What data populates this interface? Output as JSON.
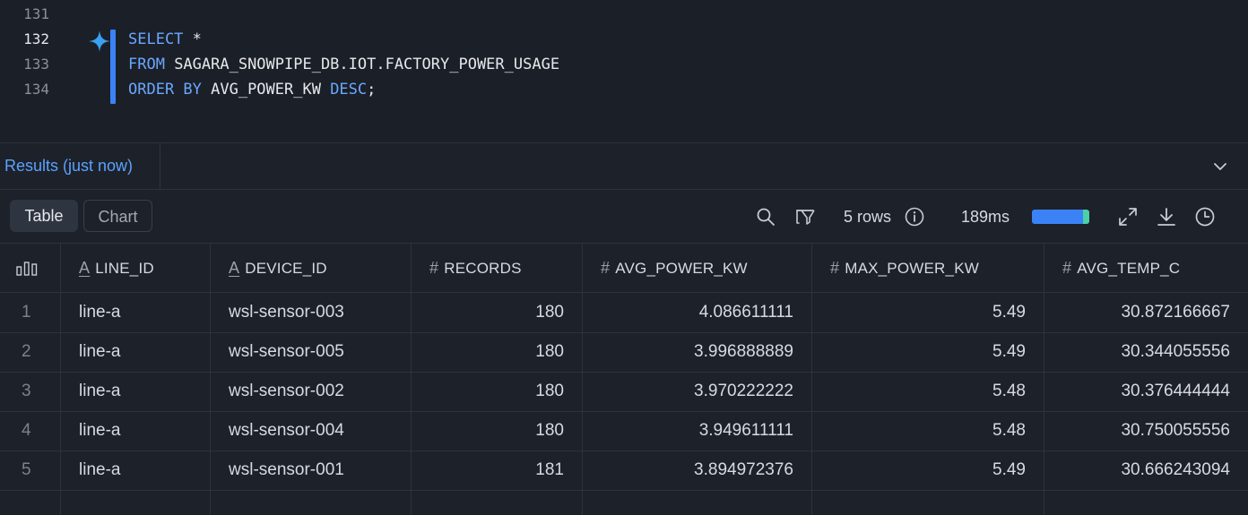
{
  "editor": {
    "lines": [
      {
        "number": "131",
        "tokens": []
      },
      {
        "number": "132",
        "tokens": [
          {
            "t": "SELECT",
            "kw": true
          },
          {
            "t": " *",
            "kw": false
          }
        ]
      },
      {
        "number": "133",
        "tokens": [
          {
            "t": "FROM",
            "kw": true
          },
          {
            "t": " SAGARA_SNOWPIPE_DB.IOT.FACTORY_POWER_USAGE",
            "kw": false
          }
        ]
      },
      {
        "number": "134",
        "tokens": [
          {
            "t": "ORDER BY",
            "kw": true
          },
          {
            "t": " AVG_POWER_KW ",
            "kw": false
          },
          {
            "t": "DESC",
            "kw": true
          },
          {
            "t": ";",
            "kw": false
          }
        ]
      }
    ],
    "active_line": "132",
    "gutter_icon": "ai-sparkle-icon"
  },
  "results": {
    "tab_label": "Results (just now)",
    "collapse_icon": "chevron-down-icon",
    "view_tabs": {
      "table": "Table",
      "chart": "Chart"
    },
    "row_count": "5 rows",
    "duration": "189ms",
    "duration_progress": 1.0,
    "icons": [
      "search-icon",
      "filter-icon",
      "info-icon",
      "expand-icon",
      "download-icon",
      "history-icon"
    ],
    "columns": [
      {
        "name": "",
        "type": "stats"
      },
      {
        "name": "LINE_ID",
        "type": "A"
      },
      {
        "name": "DEVICE_ID",
        "type": "A"
      },
      {
        "name": "RECORDS",
        "type": "#"
      },
      {
        "name": "AVG_POWER_KW",
        "type": "#"
      },
      {
        "name": "MAX_POWER_KW",
        "type": "#"
      },
      {
        "name": "AVG_TEMP_C",
        "type": "#"
      }
    ],
    "rows": [
      [
        "1",
        "line-a",
        "wsl-sensor-003",
        "180",
        "4.086611111",
        "5.49",
        "30.872166667"
      ],
      [
        "2",
        "line-a",
        "wsl-sensor-005",
        "180",
        "3.996888889",
        "5.49",
        "30.344055556"
      ],
      [
        "3",
        "line-a",
        "wsl-sensor-002",
        "180",
        "3.970222222",
        "5.48",
        "30.376444444"
      ],
      [
        "4",
        "line-a",
        "wsl-sensor-004",
        "180",
        "3.949611111",
        "5.48",
        "30.750055556"
      ],
      [
        "5",
        "line-a",
        "wsl-sensor-001",
        "181",
        "3.894972376",
        "5.49",
        "30.666243094"
      ]
    ]
  },
  "colors": {
    "background": "#1b1f27",
    "keyword": "#6aa7ff",
    "accent": "#3b82f6",
    "progress_tail": "#4ad1a8",
    "link": "#5aa2ff"
  }
}
